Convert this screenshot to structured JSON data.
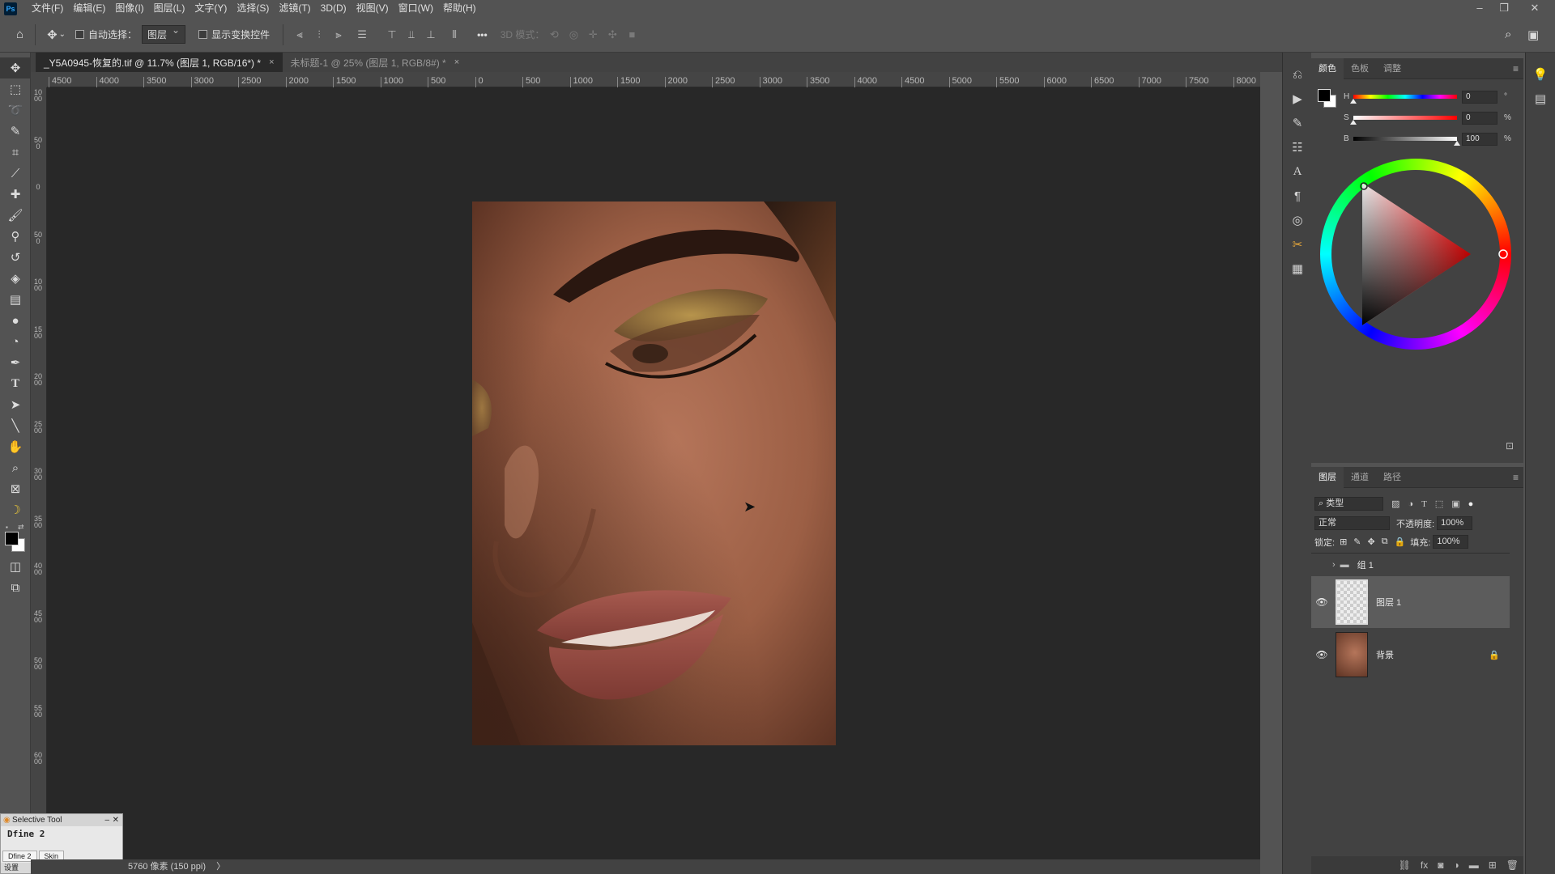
{
  "app": {
    "logo": "Ps"
  },
  "menu": [
    "文件(F)",
    "编辑(E)",
    "图像(I)",
    "图层(L)",
    "文字(Y)",
    "选择(S)",
    "滤镜(T)",
    "3D(D)",
    "视图(V)",
    "窗口(W)",
    "帮助(H)"
  ],
  "options": {
    "auto_select_label": "自动选择：",
    "auto_select_value": "图层",
    "show_transform_label": "显示变换控件",
    "mode_3d_label": "3D 模式：",
    "more_label": "•••"
  },
  "tabs": [
    {
      "label": "_Y5A0945-恢复的.tif @ 11.7% (图层 1, RGB/16*) *",
      "close": "×"
    },
    {
      "label": "未标题-1 @ 25% (图层 1, RGB/8#) *",
      "close": "×"
    }
  ],
  "ruler": {
    "h_labels": [
      "4500",
      "4000",
      "3500",
      "3000",
      "2500",
      "2000",
      "1500",
      "1000",
      "500",
      "0",
      "500",
      "1000",
      "1500",
      "2000",
      "2500",
      "3000",
      "3500",
      "4000",
      "4500",
      "5000",
      "5500",
      "6000",
      "6500",
      "7000",
      "7500",
      "8000"
    ],
    "v_labels": [
      "1000",
      "500",
      "0",
      "500",
      "1000",
      "1500",
      "2000",
      "2500",
      "3000",
      "3500",
      "4000",
      "4500",
      "5000",
      "5500",
      "6000"
    ]
  },
  "status": {
    "text": "5760 像素 (150 ppi)",
    "arrow": "〉"
  },
  "selective_tool": {
    "title": "Selective Tool",
    "plugin": "Dfine 2",
    "tabs": [
      "Dfine 2",
      "Skin"
    ],
    "footer": "设置"
  },
  "color_panel": {
    "tabs": [
      "颜色",
      "色板",
      "调整"
    ],
    "sliders": [
      {
        "label": "H",
        "value": "0",
        "unit": "°",
        "position": 0
      },
      {
        "label": "S",
        "value": "0",
        "unit": "%",
        "position": 0
      },
      {
        "label": "B",
        "value": "100",
        "unit": "%",
        "position": 1
      }
    ],
    "foreground": "#000000",
    "background": "#ffffff"
  },
  "layers_panel": {
    "tabs": [
      "图层",
      "通道",
      "路径"
    ],
    "filter_label": "类型",
    "blend_mode": "正常",
    "opacity_label": "不透明度:",
    "opacity_value": "100%",
    "lock_label": "锁定:",
    "fill_label": "填充:",
    "fill_value": "100%",
    "layers": [
      {
        "name": "组 1",
        "type": "group",
        "visible": false
      },
      {
        "name": "图层 1",
        "type": "pixel",
        "visible": true,
        "selected": true
      },
      {
        "name": "背景",
        "type": "background",
        "visible": true,
        "locked": true
      }
    ]
  }
}
